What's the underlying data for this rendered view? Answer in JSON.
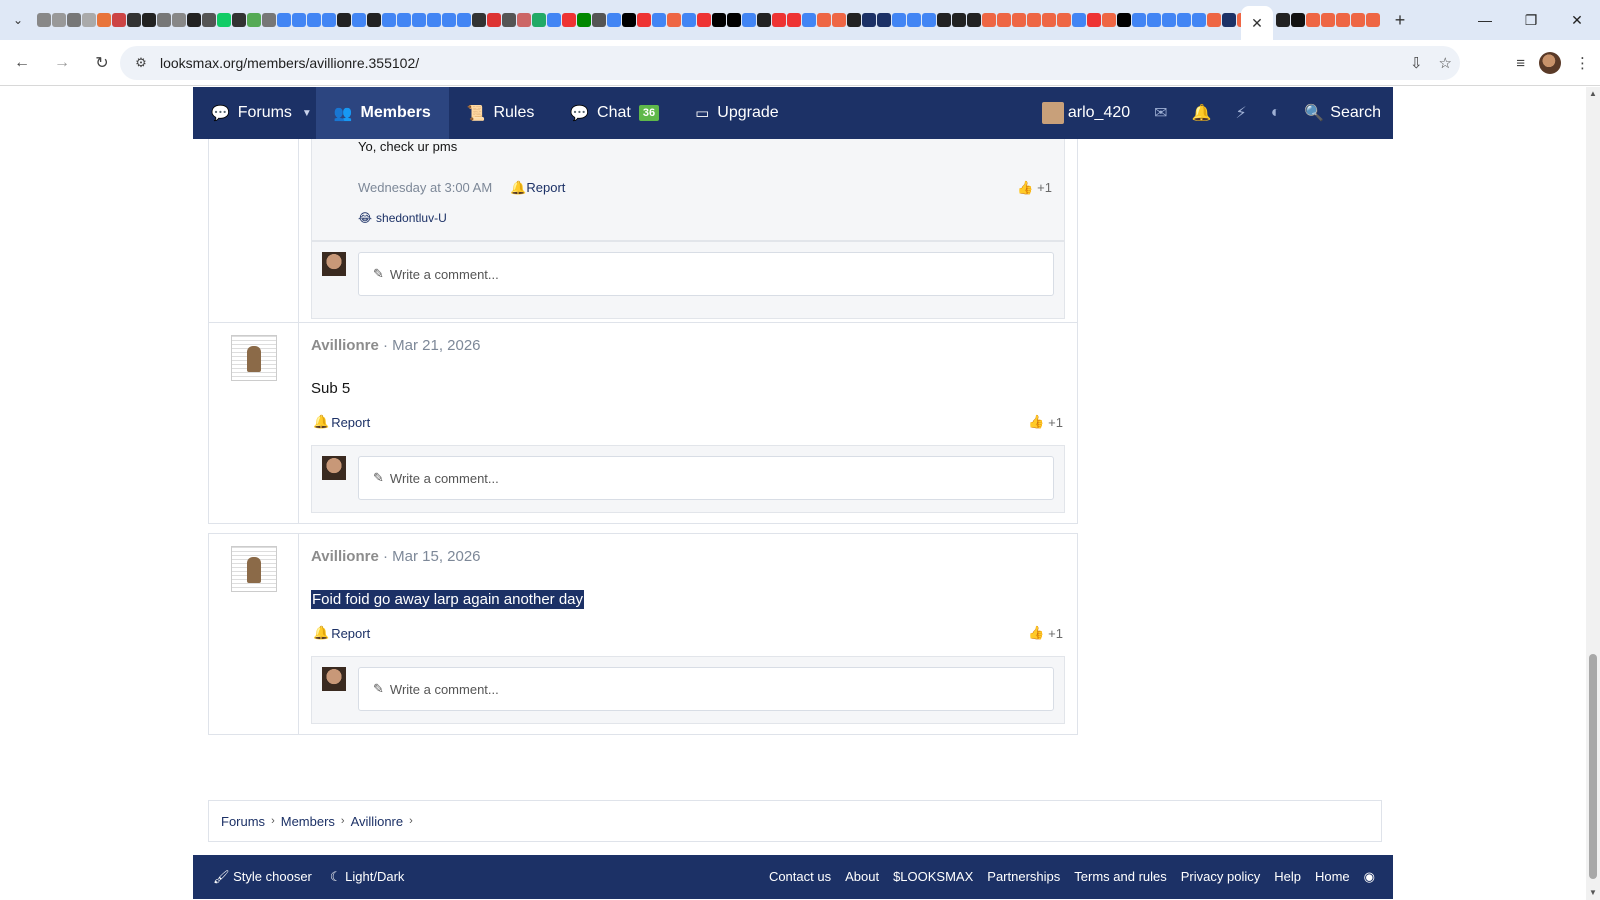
{
  "browser": {
    "url": "looksmax.org/members/avillionre.355102/",
    "favicon_colors": [
      "#888",
      "#999",
      "#777",
      "#aaa",
      "#e8743b",
      "#c44",
      "#333",
      "#222",
      "#777",
      "#888",
      "#222",
      "#555",
      "#1c6",
      "#333",
      "#5a5",
      "#777",
      "#4285f4",
      "#4285f4",
      "#4285f4",
      "#4285f4",
      "#222",
      "#4285f4",
      "#222",
      "#4285f4",
      "#4285f4",
      "#4285f4",
      "#4285f4",
      "#4285f4",
      "#4285f4",
      "#333",
      "#d33",
      "#555",
      "#c66",
      "#2a6",
      "#4285f4",
      "#e33",
      "#080",
      "#555",
      "#4285f4",
      "#000",
      "#e33",
      "#4285f4",
      "#e64",
      "#4285f4",
      "#e33",
      "#000",
      "#000",
      "#4285f4",
      "#222",
      "#e33",
      "#e33",
      "#4285f4",
      "#e64",
      "#e64",
      "#222",
      "#1c3166",
      "#1c3166",
      "#4285f4",
      "#4285f4",
      "#4285f4",
      "#222",
      "#222",
      "#222",
      "#e64",
      "#e64",
      "#e64",
      "#e64",
      "#e64",
      "#e64",
      "#4285f4",
      "#e33",
      "#e64",
      "#000",
      "#4285f4",
      "#4285f4",
      "#4285f4",
      "#4285f4",
      "#4285f4",
      "#e64",
      "#1c3166",
      "#e64",
      "#e64",
      "#4285f4",
      "#e33",
      "#e64",
      "#e64",
      "#4285f4"
    ],
    "favicon_colors_2": [
      "#222",
      "#111",
      "#e64",
      "#e64",
      "#e64",
      "#e64",
      "#e64"
    ]
  },
  "nav": {
    "forums": "Forums",
    "members": "Members",
    "rules": "Rules",
    "chat": "Chat",
    "chat_count": "36",
    "upgrade": "Upgrade",
    "username": "arlo_420",
    "search": "Search"
  },
  "partial_post": {
    "reply_text": "Yo, check ur pms",
    "reply_time": "Wednesday at 3:00 AM",
    "report": "Report",
    "like_count": "+1",
    "reaction_user": "shedontluv-U",
    "comment_placeholder": "Write a comment..."
  },
  "posts": [
    {
      "user": "Avillionre",
      "separator": "·",
      "date": "Mar 21, 2026",
      "body": "Sub 5",
      "report": "Report",
      "like_count": "+1",
      "comment_placeholder": "Write a comment..."
    },
    {
      "user": "Avillionre",
      "separator": "·",
      "date": "Mar 15, 2026",
      "body": "Foid foid go away larp again another day",
      "report": "Report",
      "like_count": "+1",
      "comment_placeholder": "Write a comment..."
    }
  ],
  "breadcrumb": [
    "Forums",
    "Members",
    "Avillionre"
  ],
  "footer": {
    "style_chooser": "Style chooser",
    "light_dark": "Light/Dark",
    "links": [
      "Contact us",
      "About",
      "$LOOKSMAX",
      "Partnerships",
      "Terms and rules",
      "Privacy policy",
      "Help",
      "Home"
    ]
  }
}
